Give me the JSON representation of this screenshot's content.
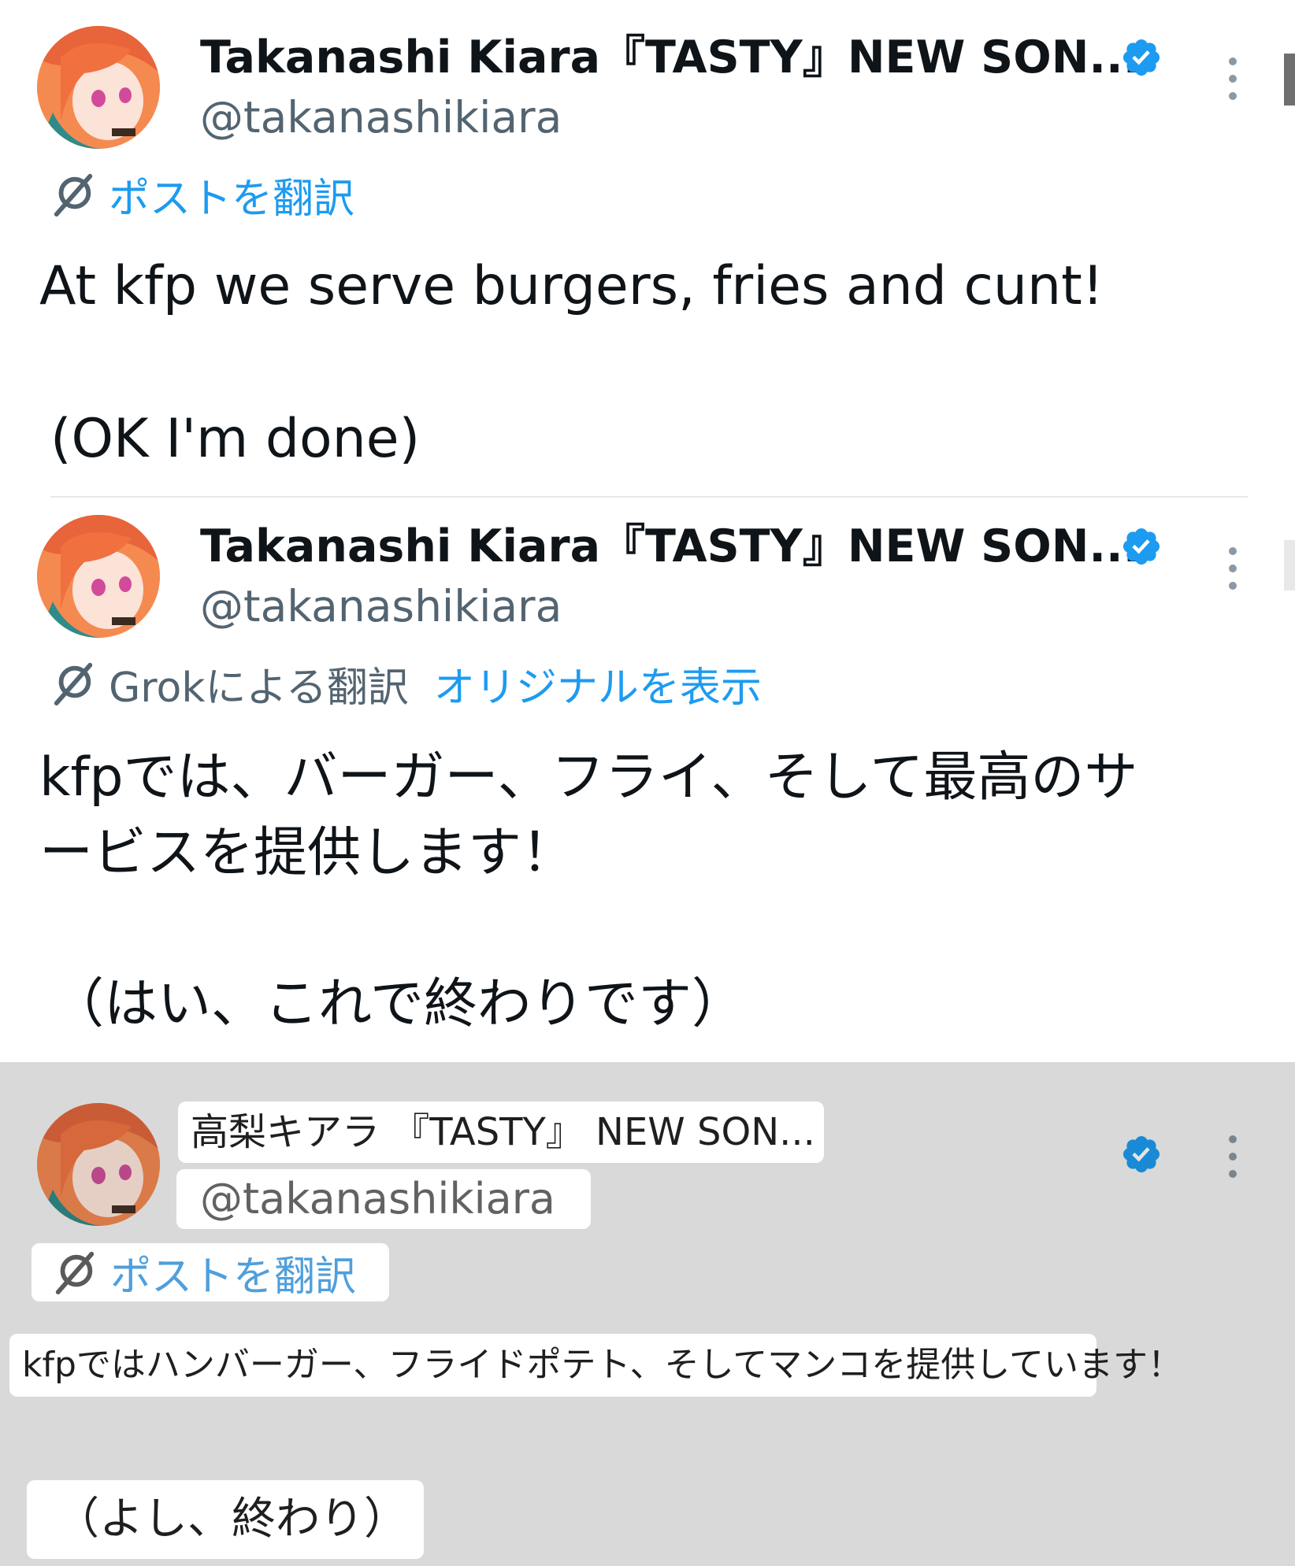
{
  "post1": {
    "display_name": "Takanashi Kiara『TASTY』NEW SON...",
    "handle": "@takanashikiara",
    "translate_link": "ポストを翻訳",
    "text_line1": "At kfp we serve burgers, fries and cunt!",
    "text_line2": "(OK I'm done)"
  },
  "post2": {
    "display_name": "Takanashi Kiara『TASTY』NEW SON...",
    "handle": "@takanashikiara",
    "translated_by": "Grokによる翻訳",
    "show_original": "オリジナルを表示",
    "text_line1": "kfpでは、バーガー、フライ、そして最高のサ",
    "text_line2": "ービスを提供します！",
    "text_line3": "（はい、これで終わりです）"
  },
  "post3": {
    "display_name": "高梨キアラ 『TASTY』 NEW SON...",
    "handle": "@takanashikiara",
    "translate_link": "ポストを翻訳",
    "text_line1": "kfpではハンバーガー、フライドポテト、そしてマンコを提供しています！",
    "text_line2": "（よし、終わり）"
  },
  "colors": {
    "link_blue": "#1d9bf0",
    "secondary_grey": "#536471",
    "overlay_grey": "#d9d9d9",
    "verified_blue": "#1d9bf0"
  },
  "icons": [
    "avatar",
    "verified-badge-icon",
    "more-options-icon",
    "translate-icon"
  ]
}
